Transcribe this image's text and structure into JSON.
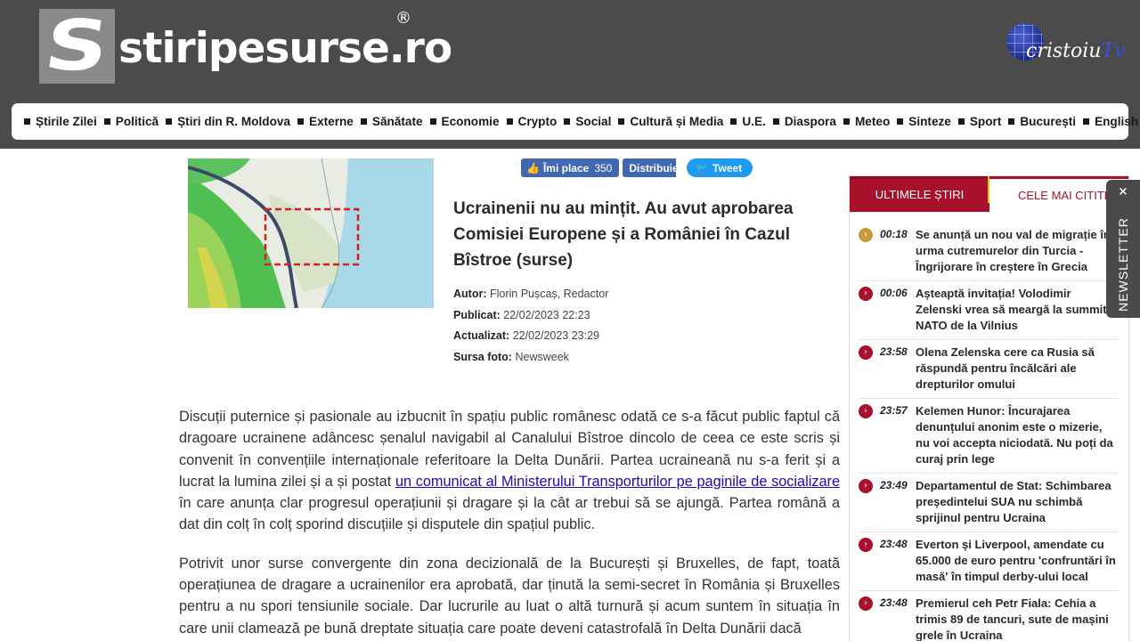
{
  "header": {
    "logo_letter": "S",
    "logo_text": "stiripesurse.ro",
    "registered": "®",
    "tv_brand_a": "cristoiu",
    "tv_brand_b": "Tv"
  },
  "nav": {
    "items": [
      "Știrile Zilei",
      "Politică",
      "Știri din R. Moldova",
      "Externe",
      "Sănătate",
      "Economie",
      "Crypto",
      "Social",
      "Cultură și Media",
      "U.E.",
      "Diaspora",
      "Meteo",
      "Sinteze",
      "Sport",
      "București",
      "English"
    ]
  },
  "social": {
    "like_label": "Îmi place",
    "like_count": "350",
    "share_label": "Distribuie",
    "tweet_label": "Tweet"
  },
  "article": {
    "title": "Ucrainenii nu au mințit. Au avut aprobarea Comisiei Europene și a României în Cazul Bîstroe (surse)",
    "author_label": "Autor:",
    "author": "Florin Pușcaș, Redactor",
    "published_label": "Publicat:",
    "published": "22/02/2023 22:23",
    "updated_label": "Actualizat:",
    "updated": "22/02/2023 23:29",
    "photo_label": "Sursa foto:",
    "photo_source": "Newsweek",
    "p1_before": "Discuții puternice și pasionale au izbucnit în spațiu public românesc odată ce s-a făcut public faptul că dragoare ucrainene adâncesc șenalul navigabil al Canalului Bîstroe dincolo de ceea ce este scris și convenit în convențiile internaționale referitoare la Delta Dunării. Partea ucraineană nu s-a ferit și a lucrat la lumina zilei și a și postat ",
    "p1_link": "un comunicat al Ministerului Transporturilor pe paginile de socializare",
    "p1_after": " în care anunța clar progresul operațiunii și dragare și la cât ar trebui să se ajungă. Partea română a dat din colț în colț sporind discuțiile și disputele din spațiul public.",
    "p2": "Potrivit unor surse convergente din zona decizională de la București și Bruxelles, de fapt, toată operațiunea de dragare a ucrainenilor era aprobată, dar ținută la semi-secret în România și Bruxelles pentru a nu spori tensiunile sociale. Dar lucrurile au luat o altă turnură și acum suntem în situația în care unii clamează pe bună dreptate situația care poate deveni catastrofală în Delta Dunării dacă"
  },
  "sidebar": {
    "tab_latest": "ULTIMELE ȘTIRI",
    "tab_most_read": "CELE MAI CITITE",
    "news": [
      {
        "time": "00:18",
        "title": "Se anunță un nou val de migrație în urma cutremurelor din Turcia - Îngrijorare în creștere în Grecia"
      },
      {
        "time": "00:06",
        "title": "Așteaptă invitația! Volodimir Zelenski vrea să meargă la summitul NATO de la Vilnius"
      },
      {
        "time": "23:58",
        "title": "Olena Zelenska cere ca Rusia să răspundă pentru încălcări ale drepturilor omului"
      },
      {
        "time": "23:57",
        "title": "Kelemen Hunor: Încurajarea denunțului anonim este o mizerie, nu voi accepta niciodată. Nu poți da curaj prin lege"
      },
      {
        "time": "23:49",
        "title": "Departamentul de Stat: Schimbarea președintelui SUA nu schimbă sprijinul pentru Ucraina"
      },
      {
        "time": "23:48",
        "title": "Everton și Liverpool, amendate cu 65.000 de euro pentru 'confruntări în masă' în timpul derby-ului local"
      },
      {
        "time": "23:48",
        "title": "Premierul ceh Petr Fiala: Cehia a trimis 89 de tancuri, sute de mașini grele în Ucraina"
      }
    ]
  },
  "newsletter": {
    "close": "×",
    "label": "NEWSLETTER"
  }
}
